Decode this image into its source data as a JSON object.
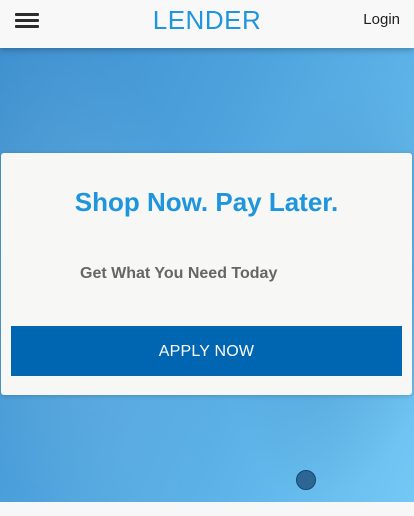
{
  "header": {
    "brand": "LENDER",
    "login_label": "Login",
    "menu_icon": "hamburger-icon"
  },
  "hero": {
    "headline": "Shop Now. Pay Later.",
    "subheadline": "Get What You Need Today",
    "cta_label": "APPLY NOW"
  },
  "carousel": {
    "indicator": "carousel-dot"
  },
  "colors": {
    "brand": "#1e95dc",
    "button": "#0066b2",
    "hero_start": "#3d8fce",
    "hero_end": "#74c8f5"
  }
}
